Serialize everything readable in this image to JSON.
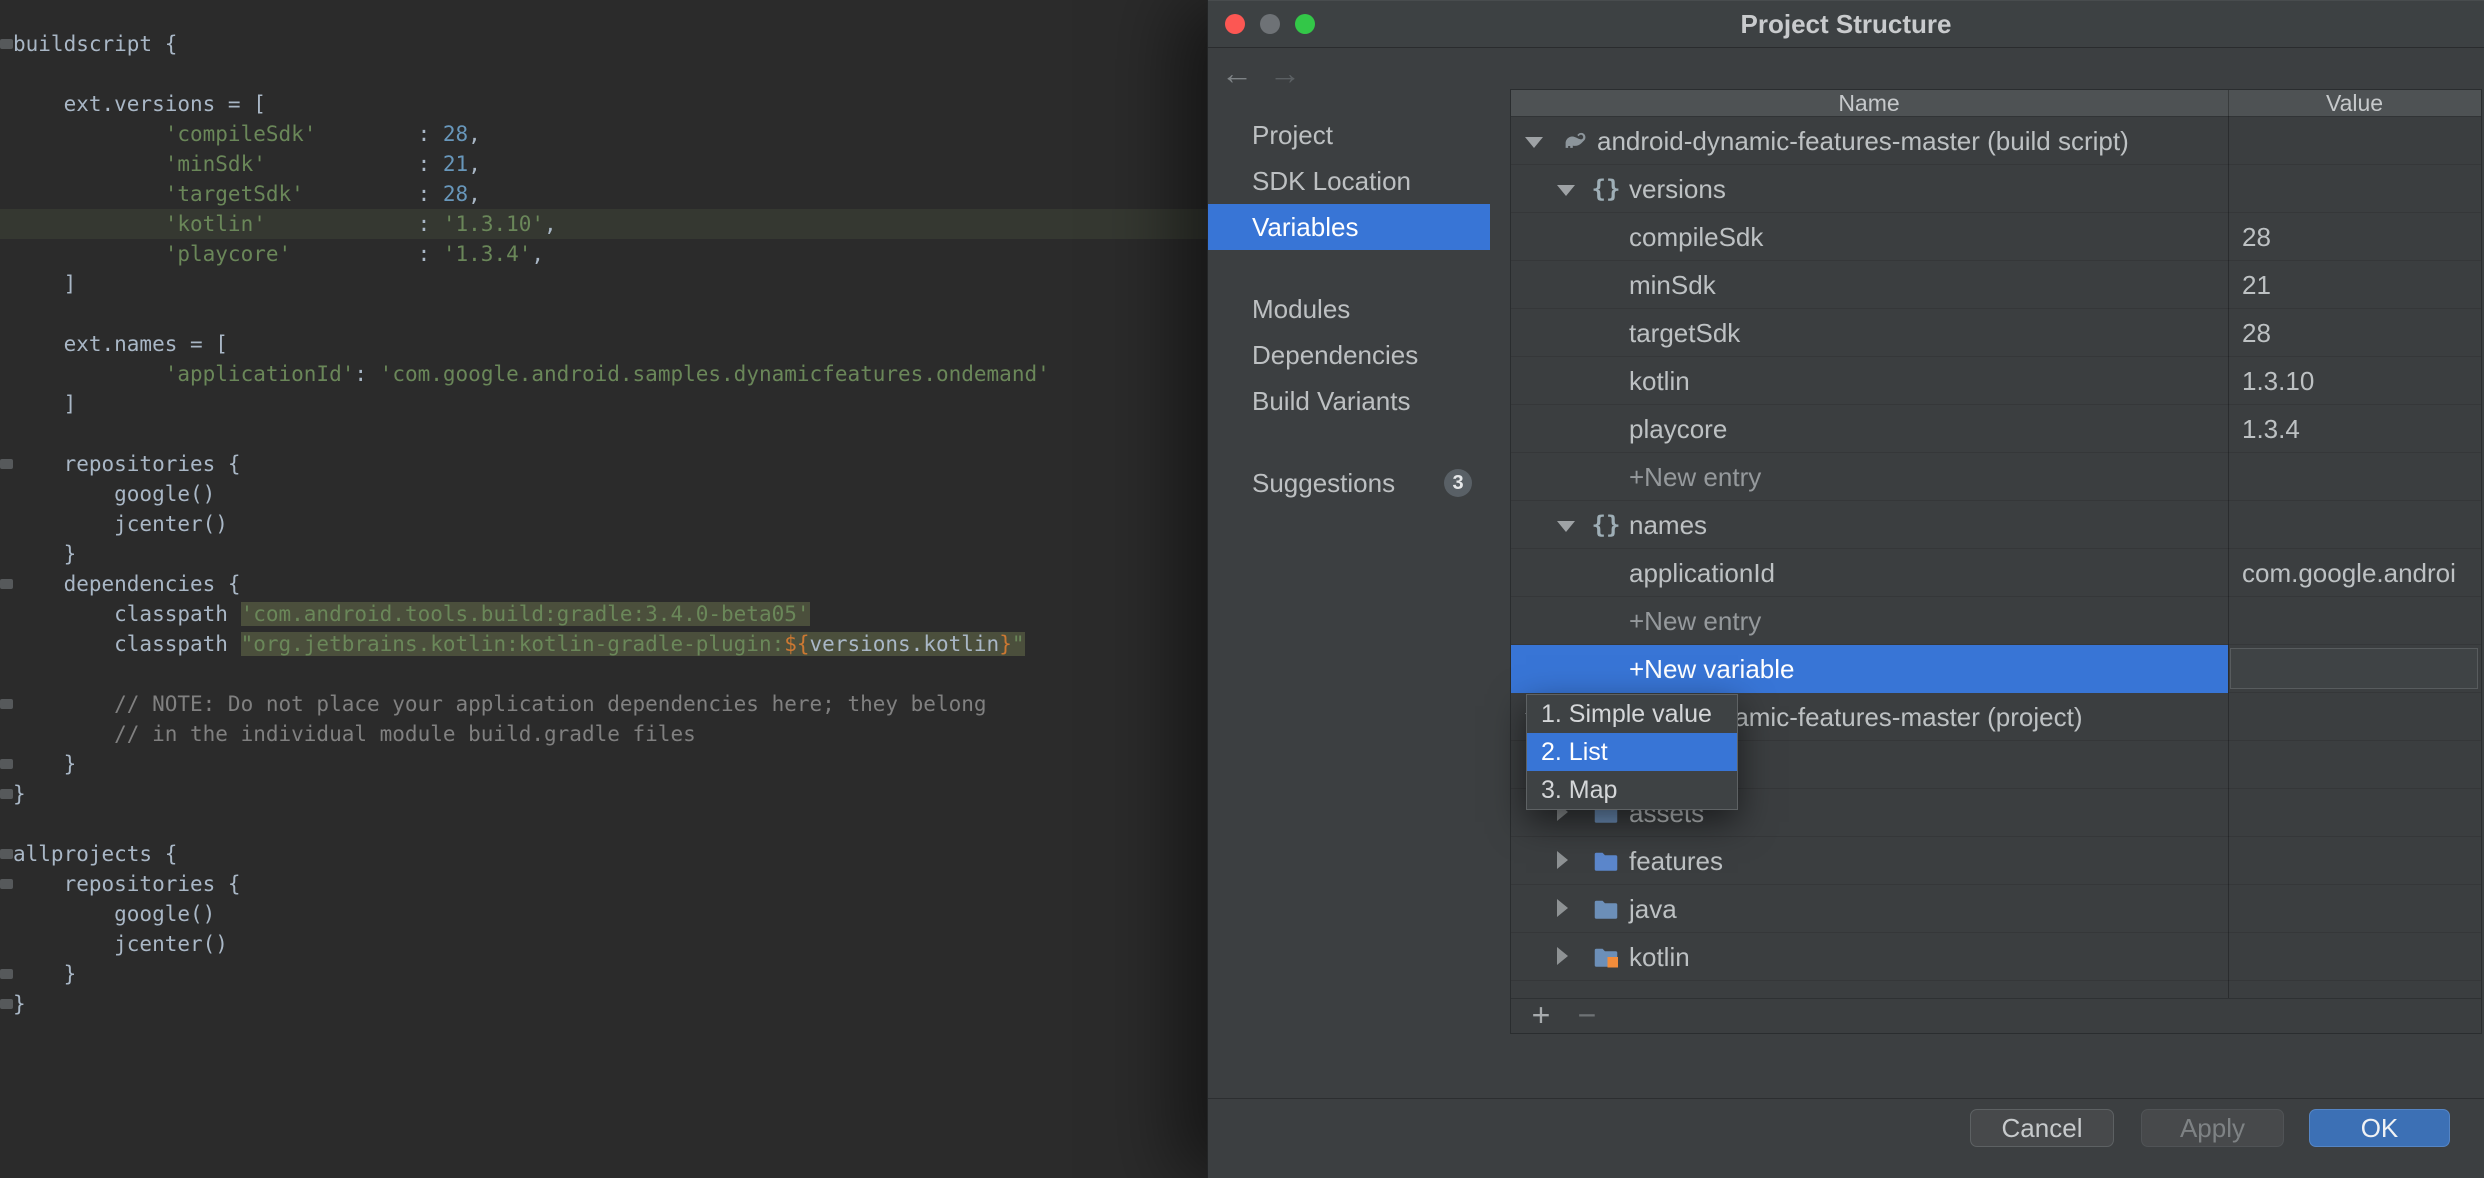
{
  "window": {
    "title": "Project Structure",
    "traffic_lights": {
      "close": "#FC5753",
      "minimize": "#6E7276",
      "zoom": "#33C748"
    }
  },
  "colors": {
    "selection": "#3875D6",
    "primary_button": "#3C70B5",
    "editor_background": "#2B2B2B"
  },
  "editor": {
    "lines": [
      {
        "mark": true,
        "segs": [
          [
            "p",
            "buildscript {"
          ]
        ]
      },
      {
        "segs": []
      },
      {
        "segs": [
          [
            "p",
            "    ext.versions = ["
          ]
        ]
      },
      {
        "segs": [
          [
            "p",
            "            "
          ],
          [
            "s",
            "'compileSdk'"
          ],
          [
            "p",
            "        : "
          ],
          [
            "n",
            "28"
          ],
          [
            "p",
            ","
          ]
        ]
      },
      {
        "segs": [
          [
            "p",
            "            "
          ],
          [
            "s",
            "'minSdk'"
          ],
          [
            "p",
            "            : "
          ],
          [
            "n",
            "21"
          ],
          [
            "p",
            ","
          ]
        ]
      },
      {
        "segs": [
          [
            "p",
            "            "
          ],
          [
            "s",
            "'targetSdk'"
          ],
          [
            "p",
            "         : "
          ],
          [
            "n",
            "28"
          ],
          [
            "p",
            ","
          ]
        ]
      },
      {
        "current": true,
        "segs": [
          [
            "p",
            "            "
          ],
          [
            "s",
            "'kotlin'"
          ],
          [
            "p",
            "            : "
          ],
          [
            "s",
            "'1.3.10'"
          ],
          [
            "p",
            ","
          ]
        ]
      },
      {
        "segs": [
          [
            "p",
            "            "
          ],
          [
            "s",
            "'playcore'"
          ],
          [
            "p",
            "          : "
          ],
          [
            "s",
            "'1.3.4'"
          ],
          [
            "p",
            ","
          ]
        ]
      },
      {
        "segs": [
          [
            "p",
            "    ]"
          ]
        ]
      },
      {
        "segs": []
      },
      {
        "segs": [
          [
            "p",
            "    ext.names = ["
          ]
        ]
      },
      {
        "segs": [
          [
            "p",
            "            "
          ],
          [
            "s",
            "'applicationId'"
          ],
          [
            "p",
            ": "
          ],
          [
            "s",
            "'com.google.android.samples.dynamicfeatures.ondemand'"
          ]
        ]
      },
      {
        "segs": [
          [
            "p",
            "    ]"
          ]
        ]
      },
      {
        "segs": []
      },
      {
        "mark": true,
        "segs": [
          [
            "p",
            "    repositories {"
          ]
        ]
      },
      {
        "segs": [
          [
            "p",
            "        google()"
          ]
        ]
      },
      {
        "segs": [
          [
            "p",
            "        jcenter()"
          ]
        ]
      },
      {
        "segs": [
          [
            "p",
            "    }"
          ]
        ]
      },
      {
        "mark": true,
        "segs": [
          [
            "p",
            "    dependencies {"
          ]
        ]
      },
      {
        "segs": [
          [
            "p",
            "        classpath "
          ],
          [
            "hs",
            "'com.android.tools.build:gradle:3.4.0-beta05'"
          ]
        ]
      },
      {
        "segs": [
          [
            "p",
            "        classpath "
          ],
          [
            "hs",
            "\"org.jetbrains.kotlin:kotlin-gradle-plugin:"
          ],
          [
            "hb",
            "${"
          ],
          [
            "hi",
            "versions.kotlin"
          ],
          [
            "hb",
            "}"
          ],
          [
            "hs",
            "\""
          ]
        ]
      },
      {
        "segs": []
      },
      {
        "mark": true,
        "segs": [
          [
            "c",
            "        // NOTE: Do not place your application dependencies here; they belong"
          ]
        ]
      },
      {
        "segs": [
          [
            "c",
            "        // in the individual module build.gradle files"
          ]
        ]
      },
      {
        "mark": true,
        "segs": [
          [
            "p",
            "    }"
          ]
        ]
      },
      {
        "mark": true,
        "segs": [
          [
            "p",
            "}"
          ]
        ]
      },
      {
        "segs": []
      },
      {
        "mark": true,
        "segs": [
          [
            "p",
            "allprojects {"
          ]
        ]
      },
      {
        "mark": true,
        "segs": [
          [
            "p",
            "    repositories {"
          ]
        ]
      },
      {
        "segs": [
          [
            "p",
            "        google()"
          ]
        ]
      },
      {
        "segs": [
          [
            "p",
            "        jcenter()"
          ]
        ]
      },
      {
        "mark": true,
        "segs": [
          [
            "p",
            "    }"
          ]
        ]
      },
      {
        "mark": true,
        "segs": [
          [
            "p",
            "}"
          ]
        ]
      }
    ]
  },
  "dialog": {
    "nav": {
      "back": "←",
      "forward": "→"
    },
    "sidebar": [
      {
        "label": "Project"
      },
      {
        "label": "SDK Location"
      },
      {
        "label": "Variables",
        "selected": true
      },
      {
        "label": "Modules"
      },
      {
        "label": "Dependencies"
      },
      {
        "label": "Build Variants"
      },
      {
        "label": "Suggestions",
        "badge": "3"
      }
    ],
    "table": {
      "columns": [
        "Name",
        "Value"
      ],
      "rows": [
        {
          "level": 0,
          "arrow": "open",
          "icon": "gradle",
          "name": "android-dynamic-features-master (build script)",
          "value": ""
        },
        {
          "level": 1,
          "arrow": "open",
          "icon": "braces",
          "name": "versions",
          "value": ""
        },
        {
          "level": 2,
          "name": "compileSdk",
          "value": "28"
        },
        {
          "level": 2,
          "name": "minSdk",
          "value": "21"
        },
        {
          "level": 2,
          "name": "targetSdk",
          "value": "28"
        },
        {
          "level": 2,
          "name": "kotlin",
          "value": "1.3.10"
        },
        {
          "level": 2,
          "name": "playcore",
          "value": "1.3.4"
        },
        {
          "level": 2,
          "name": "+New entry",
          "muted": true,
          "value": ""
        },
        {
          "level": 1,
          "arrow": "open",
          "icon": "braces",
          "name": "names",
          "value": ""
        },
        {
          "level": 2,
          "name": "applicationId",
          "value": "com.google.androi"
        },
        {
          "level": 2,
          "name": "+New entry",
          "muted": true,
          "value": ""
        },
        {
          "level": 2,
          "name": "+New variable",
          "selected": true,
          "editing": true,
          "value": ""
        },
        {
          "level": 0,
          "arrow": "open",
          "icon": "gradle",
          "name": "android-dynamic-features-master (project)",
          "value": ""
        },
        {
          "level": 1,
          "name": "",
          "value": ""
        },
        {
          "level": 1,
          "arrow": "closed",
          "icon": "folder",
          "name": "assets",
          "value": ""
        },
        {
          "level": 1,
          "arrow": "closed",
          "icon": "folder-features",
          "name": "features",
          "value": ""
        },
        {
          "level": 1,
          "arrow": "closed",
          "icon": "folder",
          "name": "java",
          "value": ""
        },
        {
          "level": 1,
          "arrow": "closed",
          "icon": "folder-kotlin",
          "name": "kotlin",
          "value": ""
        }
      ]
    },
    "popup": {
      "items": [
        {
          "label": "1. Simple value"
        },
        {
          "label": "2. List",
          "selected": true
        },
        {
          "label": "3. Map"
        }
      ]
    },
    "toolbar": {
      "add": "+",
      "remove": "−"
    },
    "buttons": [
      {
        "label": "Cancel",
        "kind": "normal"
      },
      {
        "label": "Apply",
        "kind": "disabled"
      },
      {
        "label": "OK",
        "kind": "primary"
      }
    ]
  }
}
